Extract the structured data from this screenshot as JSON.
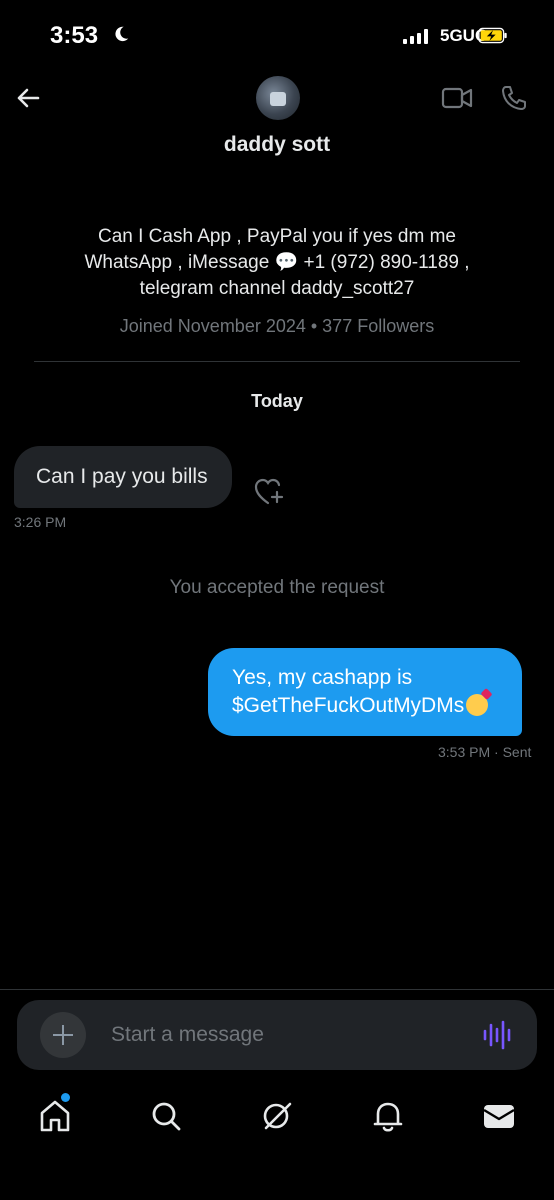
{
  "status_bar": {
    "time": "3:53",
    "network": "5GUC"
  },
  "header": {
    "username": "daddy sott",
    "bio_lines": [
      "Can I Cash App , PayPal you if yes dm me",
      "WhatsApp , iMessage 💬 +1 (972) 890-1189 ,",
      "telegram channel daddy_scott27"
    ],
    "meta": "Joined November 2024 • 377 Followers"
  },
  "conversation": {
    "day_label": "Today",
    "received": {
      "text": "Can I pay you bills",
      "time": "3:26 PM"
    },
    "system_message": "You accepted the request",
    "sent": {
      "line1": "Yes, my cashapp is",
      "line2": "$GetTheFuckOutMyDMs",
      "emoji": "kissing-face-emoji",
      "time": "3:53 PM · Sent"
    }
  },
  "composer": {
    "placeholder": "Start a message"
  },
  "tabs": [
    "home",
    "search",
    "grok",
    "notifications",
    "messages"
  ],
  "colors": {
    "accent": "#1d9bf0",
    "bubble_in": "#202327",
    "muted": "#71767b",
    "voice": "#7856ff"
  }
}
